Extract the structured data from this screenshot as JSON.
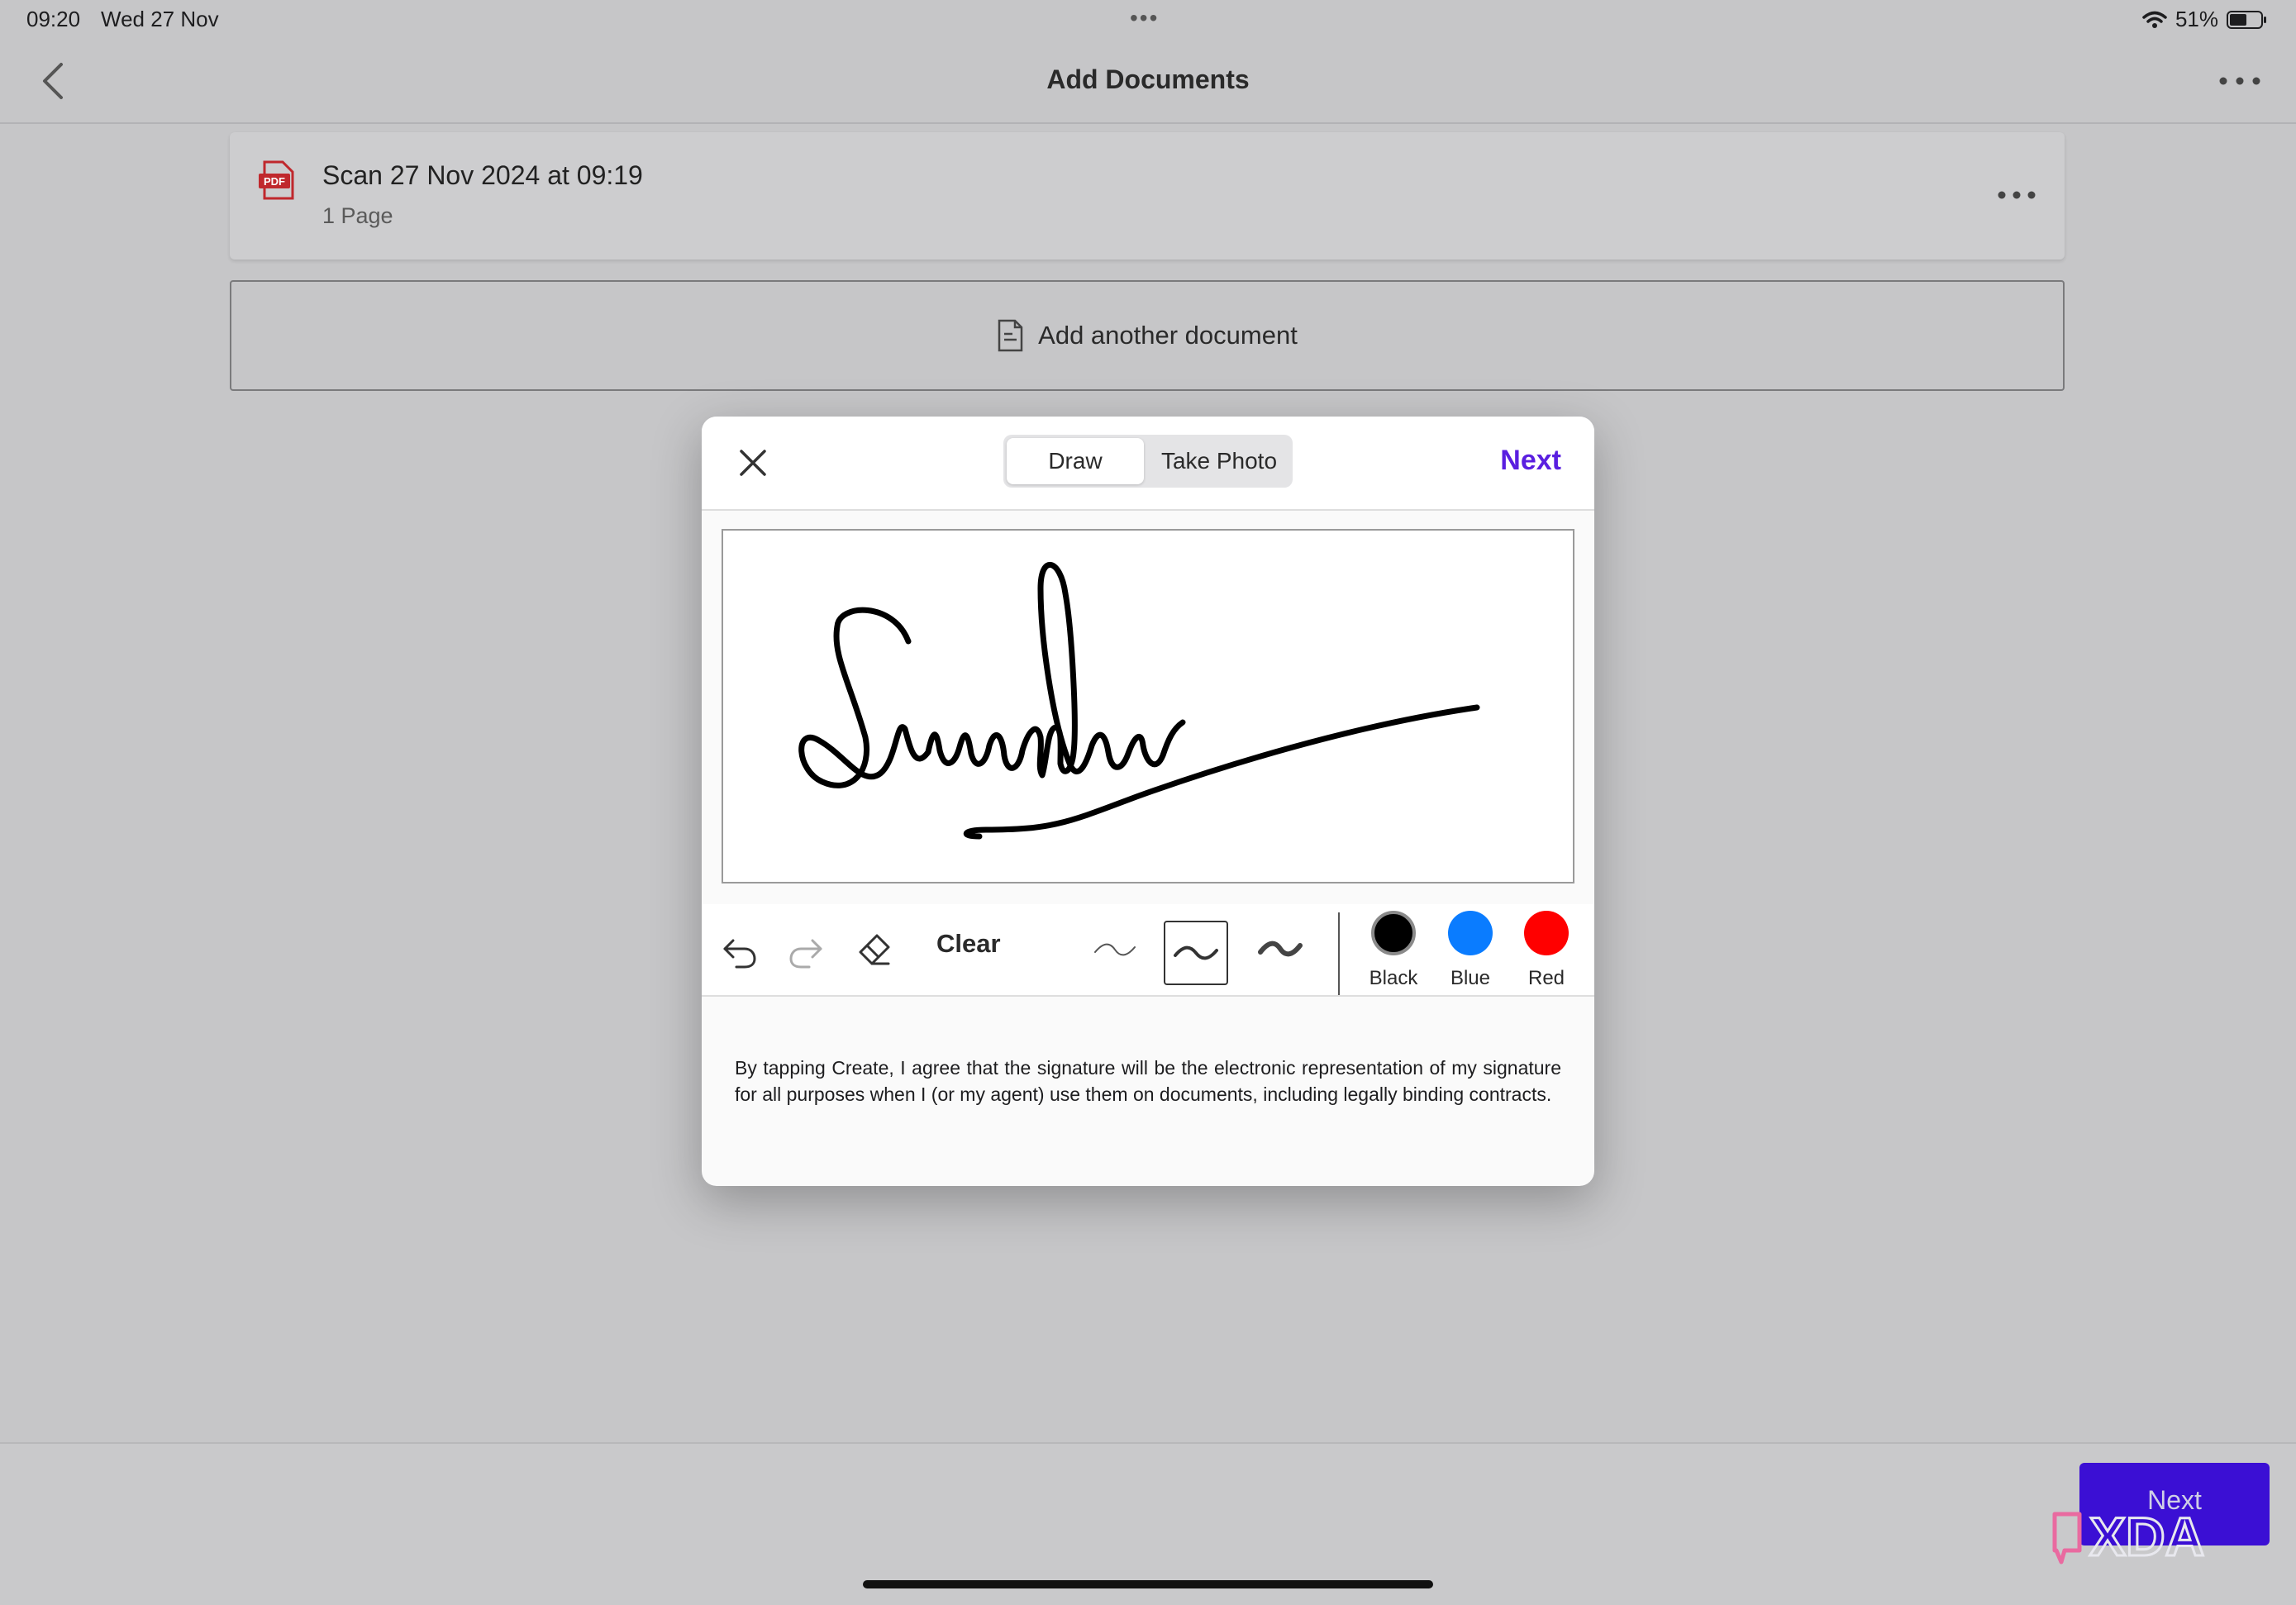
{
  "status_bar": {
    "time": "09:20",
    "date": "Wed 27 Nov",
    "battery": "51%"
  },
  "nav": {
    "title": "Add Documents"
  },
  "document": {
    "name": "Scan 27 Nov 2024 at 09:19",
    "pages": "1 Page",
    "icon_label": "PDF"
  },
  "add_document": {
    "label": "Add another document"
  },
  "modal": {
    "tabs": [
      {
        "label": "Draw",
        "selected": true
      },
      {
        "label": "Take Photo",
        "selected": false
      }
    ],
    "next_label": "Next",
    "tools": {
      "clear_label": "Clear",
      "selected_stroke": "medium"
    },
    "colors": [
      {
        "label": "Black",
        "hex": "#000000",
        "selected": true
      },
      {
        "label": "Blue",
        "hex": "#0a7cff",
        "selected": false
      },
      {
        "label": "Red",
        "hex": "#ff0000",
        "selected": false
      }
    ],
    "disclaimer": "By tapping Create, I agree that the signature will be the electronic representation of my signature for all purposes when I (or my agent) use them on documents, including legally binding contracts."
  },
  "bottom": {
    "next_label": "Next",
    "watermark": "XDA"
  }
}
